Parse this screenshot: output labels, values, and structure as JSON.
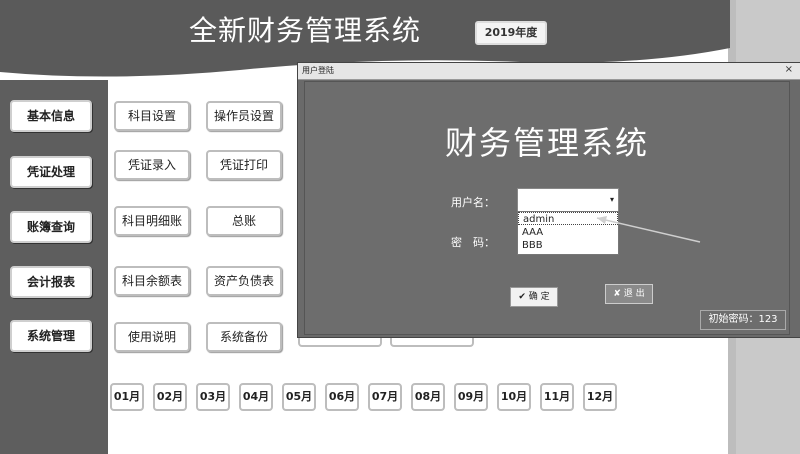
{
  "header": {
    "title": "全新财务管理系统",
    "year_badge": "2019年度"
  },
  "sidebar": {
    "items": [
      {
        "label": "基本信息"
      },
      {
        "label": "凭证处理"
      },
      {
        "label": "账簿查询"
      },
      {
        "label": "会计报表"
      },
      {
        "label": "系统管理"
      }
    ]
  },
  "main": {
    "buttons": [
      {
        "label": "科目设置"
      },
      {
        "label": "操作员设置"
      },
      {
        "label": "凭证录入"
      },
      {
        "label": "凭证打印"
      },
      {
        "label": "科目明细账"
      },
      {
        "label": "总账"
      },
      {
        "label": "科目余额表"
      },
      {
        "label": "资产负债表"
      },
      {
        "label": "使用说明"
      },
      {
        "label": "系统备份"
      }
    ],
    "months": [
      "01月",
      "02月",
      "03月",
      "04月",
      "05月",
      "06月",
      "07月",
      "08月",
      "09月",
      "10月",
      "11月",
      "12月"
    ]
  },
  "login_dialog": {
    "window_title": "用户登陆",
    "close_glyph": "×",
    "heading": "财务管理系统",
    "username_label": "用户名：",
    "password_label": "密　码：",
    "username_value": "",
    "dropdown_arrow": "▾",
    "user_options": [
      "admin",
      "AAA",
      "BBB"
    ],
    "ok_button": "✔ 确 定",
    "exit_button": "✘ 退 出",
    "initial_password": "初始密码：123"
  },
  "colors": {
    "banner": "#5a5a5a",
    "sidebar": "#5e5e5e",
    "dialog": "#6d6d6d"
  }
}
